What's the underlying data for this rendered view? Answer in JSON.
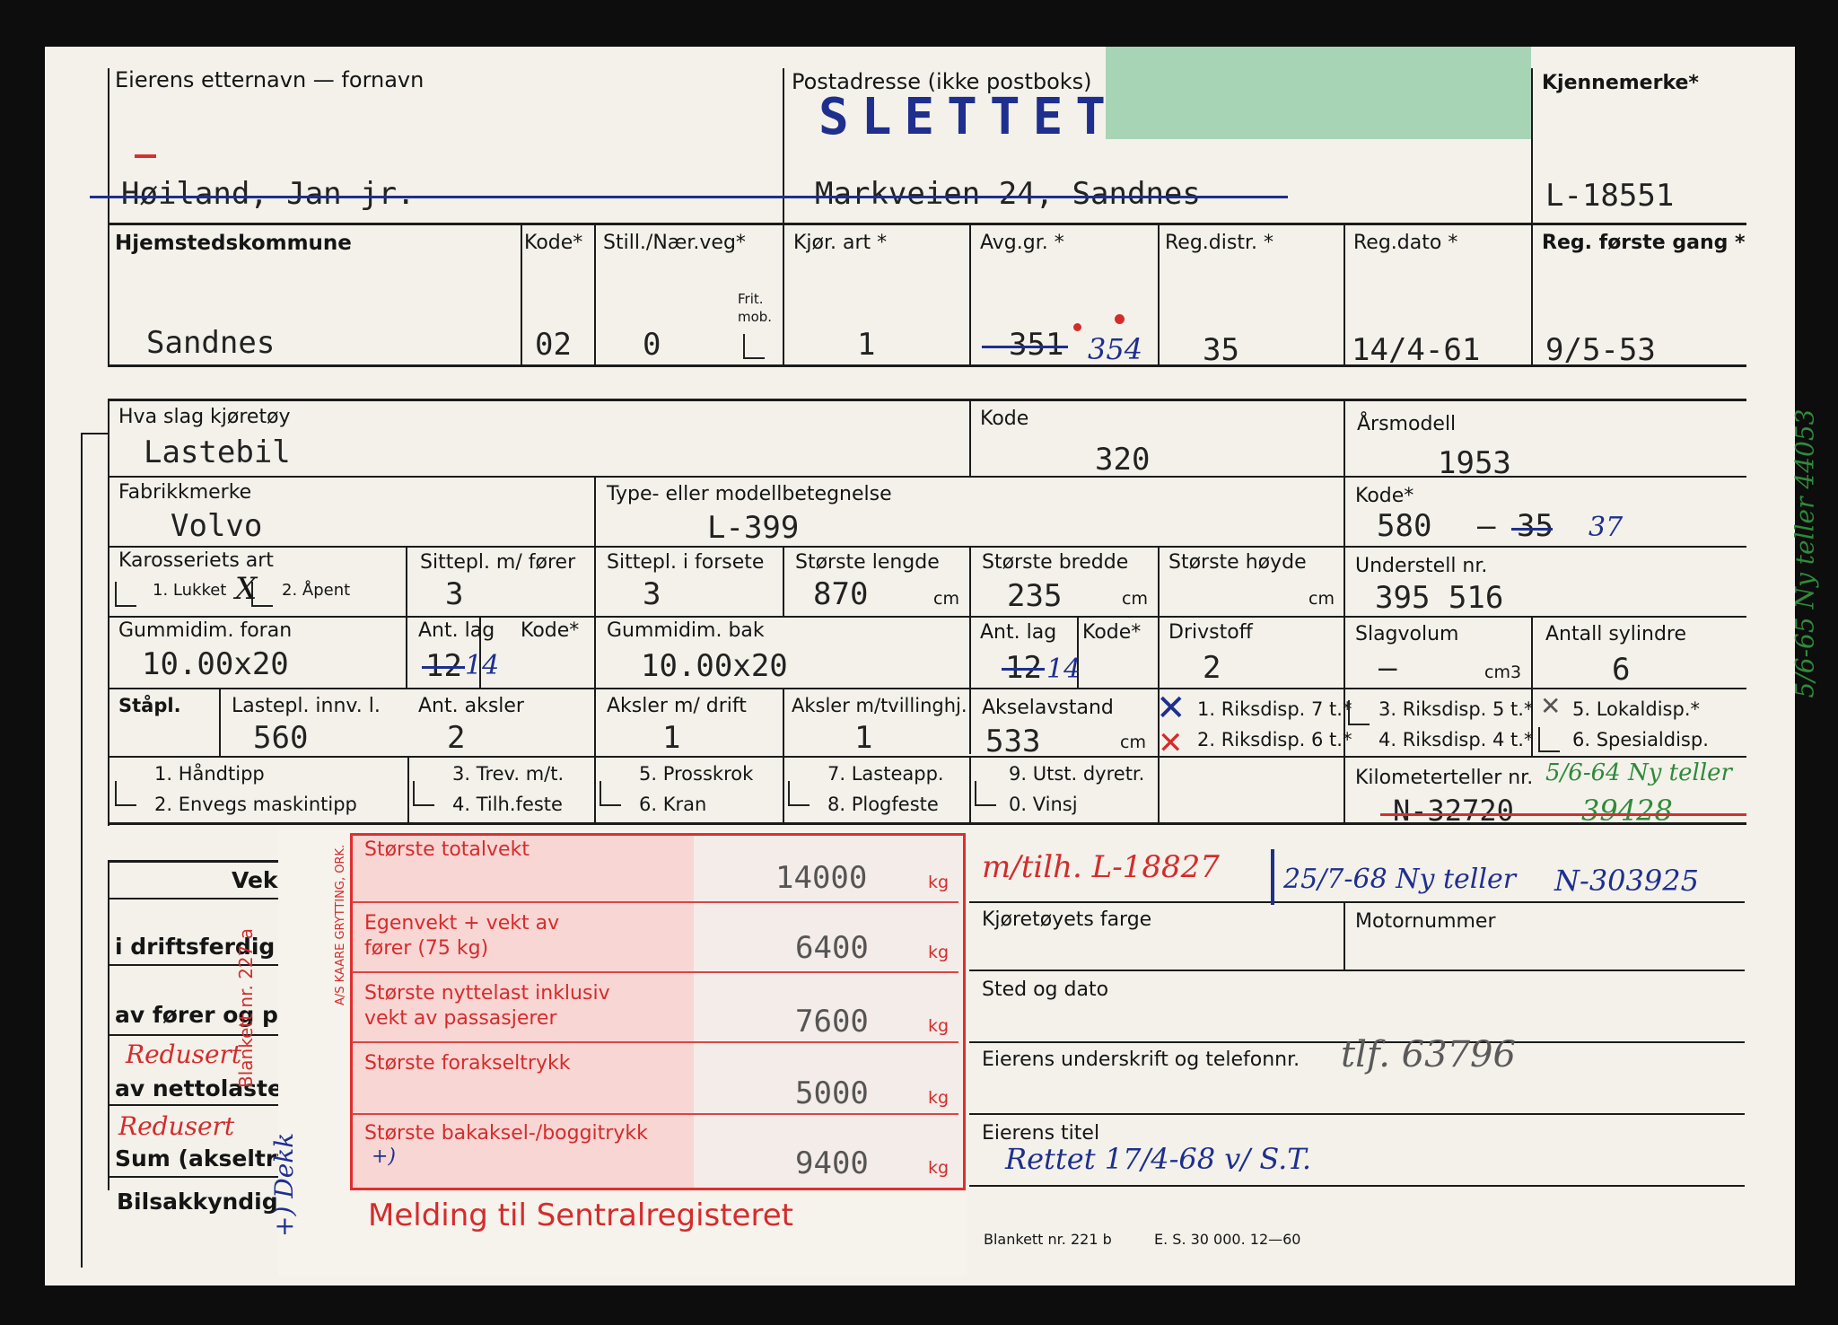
{
  "form": {
    "owner_name_label": "Eierens etternavn — fornavn",
    "postal_label": "Postadresse (ikke postboks)",
    "reg_mark_label": "Kjennemerke*",
    "stamp": "SLETTET",
    "owner_name": "Høiland, Jan jr.",
    "postal_value": "Markveien 24, Sandnes",
    "reg_mark": "L-18551",
    "home_muni_label": "Hjemstedskommune",
    "kode_label": "Kode*",
    "still_label": "Still./Nær.veg*",
    "fritmob_label": "Frit. mob.",
    "kjor_label": "Kjør. art *",
    "avg_label": "Avg.gr. *",
    "regdistr_label": "Reg.distr. *",
    "regdato_label": "Reg.dato *",
    "regforste_label": "Reg. første gang *",
    "home_muni": "Sandnes",
    "kode": "02",
    "still": "0",
    "kjor": "1",
    "avg_old": "351",
    "avg_new": "354",
    "regdistr": "35",
    "regdato": "14/4-61",
    "regforste": "9/5-53",
    "type_label": "Hva slag kjøretøy",
    "type_kode_label": "Kode",
    "arsmodell_label": "Årsmodell",
    "type": "Lastebil",
    "type_kode": "320",
    "arsmodell": "1953",
    "fabrikk_label": "Fabrikkmerke",
    "modell_label": "Type- eller modellbetegnelse",
    "kode2_label": "Kode*",
    "fabrikk": "Volvo",
    "modell": "L-399",
    "kode2": "580",
    "kode2_old": "35",
    "kode2_new": "37",
    "karosseri_label": "Karosseriets art",
    "lukket_label": "1. Lukket",
    "apent_label": "2. Åpent",
    "karosseri_mark": "X",
    "sittepl_forer_label": "Sittepl. m/ fører",
    "sittepl_forsete_label": "Sittepl. i forsete",
    "lengde_label": "Største lengde",
    "bredde_label": "Største bredde",
    "hoyde_label": "Største høyde",
    "understell_label": "Understell nr.",
    "sittepl_forer": "3",
    "sittepl_forsete": "3",
    "lengde": "870",
    "bredde": "235",
    "cm": "cm",
    "understell": "395 516",
    "gummi_foran_label": "Gummidim. foran",
    "antlag_label": "Ant. lag",
    "kode_star_label": "Kode*",
    "gummi_bak_label": "Gummidim. bak",
    "drivstoff_label": "Drivstoff",
    "slagvolum_label": "Slagvolum",
    "sylindre_label": "Antall sylindre",
    "gummi_foran": "10.00x20",
    "antlag_foran_old": "12",
    "antlag_foran_new": "14",
    "gummi_bak": "10.00x20",
    "antlag_bak_old": "12",
    "antlag_bak_new": "14",
    "drivstoff": "2",
    "slagvolum": "–",
    "cm3": "cm3",
    "sylindre": "6",
    "stapl_label": "Ståpl.",
    "lastepl_label": "Lastepl. innv. l.",
    "aksler_label": "Ant. aksler",
    "aksler_drift_label": "Aksler m/ drift",
    "aksler_tvilling_label": "Aksler m/tvillinghj.",
    "akselavstand_label": "Akselavstand",
    "riks1": "1. Riksdisp. 7 t.*",
    "riks2": "2. Riksdisp. 6 t.*",
    "riks3": "3. Riksdisp. 5 t.*",
    "riks4": "4. Riksdisp. 4 t.*",
    "lokal5": "5. Lokaldisp.*",
    "spesial6": "6. Spesialdisp.",
    "lastepl": "560",
    "aksler": "2",
    "aksler_drift": "1",
    "aksler_tvilling": "1",
    "akselavstand": "533",
    "opt1": "1. Håndtipp",
    "opt2": "2. Envegs maskintipp",
    "opt3": "3. Trev. m/t.",
    "opt4": "4. Tilh.feste",
    "opt5": "5. Prosskrok",
    "opt6": "6. Kran",
    "opt7": "7. Lasteapp.",
    "opt8": "8. Plogfeste",
    "opt9": "9. Utst. dyretr.",
    "opt0": "0. Vinsj",
    "km_label": "Kilometerteller nr.",
    "km_old": "N-32720",
    "km_old2": "39428",
    "km_note": "5/6-64 Ny teller",
    "side_note": "5/6-65 Ny teller 44053",
    "tilh_note": "m/tilh. L-18827",
    "ny_teller_note": "25/7-68 Ny teller",
    "ny_teller_value": "N-303925",
    "farge_label": "Kjøretøyets farge",
    "motornr_label": "Motornummer",
    "sted_label": "Sted og dato",
    "underskrift_label": "Eierens underskrift og telefonnr.",
    "telefon": "tlf. 63796",
    "tittel_label": "Eierens titel",
    "tittel_note": "Rettet 17/4-68 v/ S.T.",
    "blankett_221": "Blankett nr. 221 b",
    "es_label": "E. S. 30 000. 12—60",
    "vekt_label": "Vekt",
    "driftsferdig_label": "i driftsferdig st",
    "forer_label": "av fører og pa",
    "redusert": "Redusert",
    "nettolast_label": "av nettolasten",
    "sum_label": "Sum (akseltrykk",
    "bilsakk_label": "Bilsakkyndiges",
    "dekk_note": "+) Dekk",
    "blankett_227": "Blankett nr. 227 a",
    "printer": "A/S KAARE GRYTTING, ORK.",
    "kg": "kg",
    "w_total_label": "Største totalvekt",
    "w_total": "14000",
    "w_egen_label1": "Egenvekt + vekt av",
    "w_egen_label2": "fører (75 kg)",
    "w_egen": "6400",
    "w_nytte_label1": "Største nyttelast inklusiv",
    "w_nytte_label2": "vekt av passasjerer",
    "w_nytte": "7600",
    "w_forak_label": "Største forakseltrykk",
    "w_forak": "5000",
    "w_bak_label": "Største bakaksel-/boggitrykk",
    "w_bak_mark": "+)",
    "w_bak": "9400",
    "melding": "Melding til Sentralregisteret"
  }
}
